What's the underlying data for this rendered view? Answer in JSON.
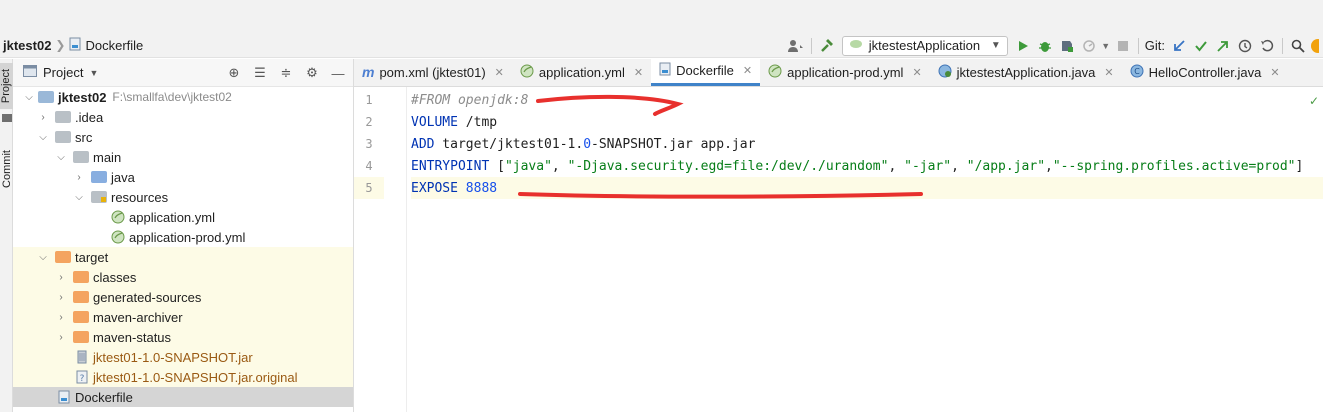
{
  "breadcrumb": {
    "project": "jktest02",
    "file": "Dockerfile"
  },
  "toolbar": {
    "run_config": "jktestestApplication",
    "git_label": "Git:"
  },
  "side_tabs": {
    "project": "Project",
    "commit": "Commit"
  },
  "project_panel": {
    "title": "Project",
    "tree": [
      {
        "label": "jktest02",
        "path": "F:\\smallfa\\dev\\jktest02"
      },
      {
        "label": ".idea"
      },
      {
        "label": "src"
      },
      {
        "label": "main"
      },
      {
        "label": "java"
      },
      {
        "label": "resources"
      },
      {
        "label": "application.yml"
      },
      {
        "label": "application-prod.yml"
      },
      {
        "label": "target"
      },
      {
        "label": "classes"
      },
      {
        "label": "generated-sources"
      },
      {
        "label": "maven-archiver"
      },
      {
        "label": "maven-status"
      },
      {
        "label": "jktest01-1.0-SNAPSHOT.jar"
      },
      {
        "label": "jktest01-1.0-SNAPSHOT.jar.original"
      },
      {
        "label": "Dockerfile"
      }
    ]
  },
  "tabs": [
    {
      "label": "pom.xml (jktest01)"
    },
    {
      "label": "application.yml"
    },
    {
      "label": "Dockerfile"
    },
    {
      "label": "application-prod.yml"
    },
    {
      "label": "jktestestApplication.java"
    },
    {
      "label": "HelloController.java"
    }
  ],
  "editor": {
    "line_numbers": [
      "1",
      "2",
      "3",
      "4",
      "5"
    ],
    "lines": {
      "l1": "#FROM openjdk:8",
      "l2_kw": "VOLUME",
      "l2_rest": " /tmp",
      "l3_kw": "ADD",
      "l3_a": " target/jktest01-1.",
      "l3_num": "0",
      "l3_b": "-SNAPSHOT.jar app.jar",
      "l4_kw": "ENTRYPOINT",
      "l4_open": " [",
      "l4_s1": "\"java\"",
      "l4_c1": ", ",
      "l4_s2": "\"-Djava.security.egd=file:/dev/./urandom\"",
      "l4_c2": ", ",
      "l4_s3": "\"-jar\"",
      "l4_c3": ", ",
      "l4_s4": "\"/app.jar\"",
      "l4_c4": ",",
      "l4_s5": "\"--spring.profiles.active=prod\"",
      "l4_close": "]",
      "l5_kw": "EXPOSE",
      "l5_sp": " ",
      "l5_num": "8888"
    }
  },
  "colors": {
    "keyword": "#0033b3",
    "string": "#067d17",
    "number": "#1750eb",
    "annotation": "#e8302d"
  }
}
